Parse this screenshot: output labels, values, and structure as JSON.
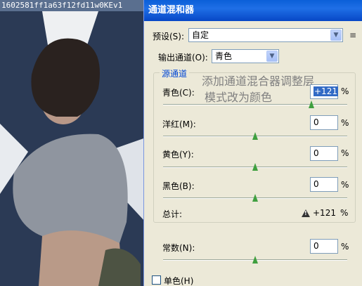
{
  "background": {
    "title": "1602581ff1a63f12fd11w0KEv1"
  },
  "dialog": {
    "title": "通道混和器",
    "preset": {
      "label": "预设(S):",
      "value": "自定"
    },
    "output_channel": {
      "label": "输出通道(O):",
      "value": "青色"
    },
    "source_group_label": "源通道",
    "overlay_text": [
      "添加通道混合器调整层",
      "模式改为颜色"
    ],
    "channels": [
      {
        "label": "青色(C):",
        "value": "+121",
        "percent": "%",
        "level": 121
      },
      {
        "label": "洋红(M):",
        "value": "0",
        "percent": "%",
        "level": 0
      },
      {
        "label": "黄色(Y):",
        "value": "0",
        "percent": "%",
        "level": 0
      },
      {
        "label": "黑色(B):",
        "value": "0",
        "percent": "%",
        "level": 0
      }
    ],
    "total": {
      "label": "总计:",
      "value": "+121",
      "percent": "%"
    },
    "constant": {
      "label": "常数(N):",
      "value": "0",
      "percent": "%",
      "level": 0
    },
    "monochrome": {
      "label": "单色(H)",
      "checked": false
    }
  },
  "colors": {
    "titlebar": "#0a5fd8",
    "dialog_bg": "#ece9d8",
    "group_label": "#0046d5",
    "slider_thumb": "#3f9f3f"
  },
  "icons": [
    "chevron-down-icon",
    "menu-icon",
    "warning-icon"
  ]
}
